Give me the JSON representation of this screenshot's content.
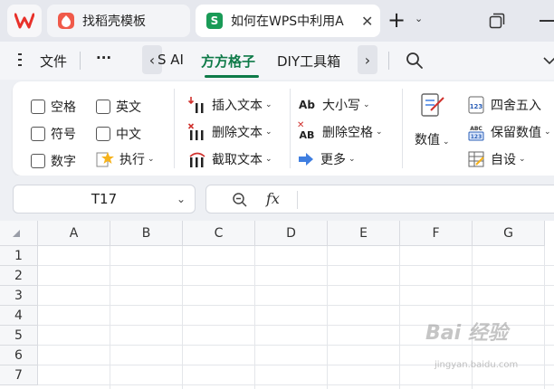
{
  "tabs": {
    "logo_name": "wps-logo",
    "items": [
      {
        "label": "找稻壳模板",
        "icon": "docer-icon",
        "icon_color": "#f05a4a"
      },
      {
        "label": "如何在WPS中利用A",
        "icon": "spreadsheet-icon",
        "icon_glyph": "S",
        "icon_color": "#1a9b57",
        "active": true
      }
    ],
    "close_glyph": "✕",
    "new_glyph": "+"
  },
  "menu": {
    "file": "文件",
    "more": "···",
    "ai": "S AI",
    "active_tab": "方方格子",
    "diy": "DIY工具箱",
    "accent": "#0e7a48"
  },
  "ribbon": {
    "checkboxes": [
      "空格",
      "英文",
      "符号",
      "中文",
      "数字"
    ],
    "execute": "执行",
    "insert_text": "插入文本",
    "delete_text": "删除文本",
    "extract_text": "截取文本",
    "case": "大小写",
    "case_icon": "Ab",
    "remove_space": "删除空格",
    "remove_space_icon": "AB",
    "more": "更多",
    "number_value": "数值",
    "round": "四舍五入",
    "keep_value": "保留数值",
    "custom": "自设",
    "badge_123": "123",
    "badge_abc": "ABC"
  },
  "formula_bar": {
    "cell_ref": "T17",
    "fx": "fx"
  },
  "grid": {
    "columns": [
      "A",
      "B",
      "C",
      "D",
      "E",
      "F",
      "G"
    ],
    "rows": [
      "1",
      "2",
      "3",
      "4",
      "5",
      "6",
      "7"
    ]
  },
  "watermark": {
    "text": "Bai 经验",
    "sub": "jingyan.baidu.com"
  }
}
